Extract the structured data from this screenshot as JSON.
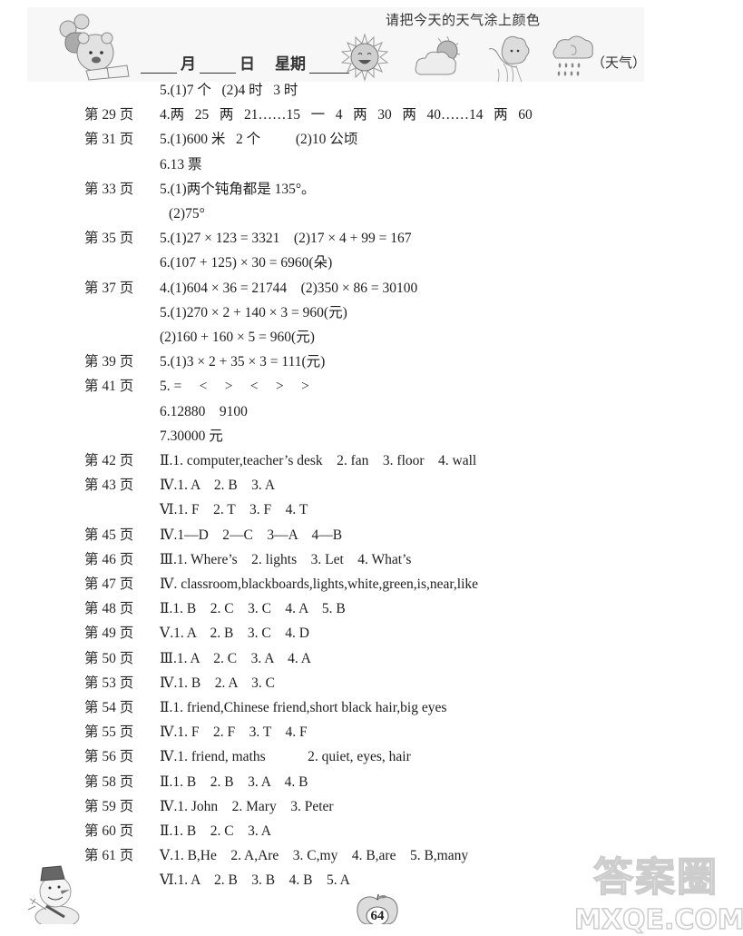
{
  "header": {
    "weather_prompt": "请把今天的天气涂上颜色",
    "month_label": "月",
    "day_label": "日",
    "weekday_label": "星期",
    "weather_label": "（天气）",
    "weather_icons": [
      "sunny-icon",
      "partly-cloudy-icon",
      "windy-icon",
      "rainy-icon"
    ]
  },
  "rows": [
    {
      "page": "",
      "answer": "5.(1)7 个   (2)4 时   3 时",
      "indent": false
    },
    {
      "page": "第 29 页",
      "answer": "4.两   25   两   21……15   一   4   两   30   两   40……14   两   60",
      "indent": false
    },
    {
      "page": "第 31 页",
      "answer": "5.(1)600 米   2 个          (2)10 公顷",
      "indent": false
    },
    {
      "page": "",
      "answer": "6.13 票",
      "indent": false
    },
    {
      "page": "第 33 页",
      "answer": "5.(1)两个钝角都是 135°。",
      "indent": false
    },
    {
      "page": "",
      "answer": "(2)75°",
      "indent": true
    },
    {
      "page": "第 35 页",
      "answer": "5.(1)27 × 123 = 3321    (2)17 × 4 + 99 = 167",
      "indent": false
    },
    {
      "page": "",
      "answer": "6.(107 + 125) × 30 = 6960(朵)",
      "indent": false
    },
    {
      "page": "第 37 页",
      "answer": "4.(1)604 × 36 = 21744    (2)350 × 86 = 30100",
      "indent": false
    },
    {
      "page": "",
      "answer": "5.(1)270 × 2 + 140 × 3 = 960(元)",
      "indent": false
    },
    {
      "page": "",
      "answer": "(2)160 + 160 × 5 = 960(元)",
      "indent": false
    },
    {
      "page": "第 39 页",
      "answer": "5.(1)3 × 2 + 35 × 3 = 111(元)",
      "indent": false
    },
    {
      "page": "第 41 页",
      "answer": "5. =     <     >     <     >     >",
      "indent": false
    },
    {
      "page": "",
      "answer": "6.12880    9100",
      "indent": false
    },
    {
      "page": "",
      "answer": "7.30000 元",
      "indent": false
    },
    {
      "page": "第 42 页",
      "answer": "Ⅱ.1. computer,teacher’s desk    2. fan    3. floor    4. wall",
      "indent": false
    },
    {
      "page": "第 43 页",
      "answer": "Ⅳ.1. A    2. B    3. A",
      "indent": false
    },
    {
      "page": "",
      "answer": "Ⅵ.1. F    2. T    3. F    4. T",
      "indent": false
    },
    {
      "page": "第 45 页",
      "answer": "Ⅳ.1—D    2—C    3—A    4—B",
      "indent": false
    },
    {
      "page": "第 46 页",
      "answer": "Ⅲ.1. Where’s    2. lights    3. Let    4. What’s",
      "indent": false
    },
    {
      "page": "第 47 页",
      "answer": "Ⅳ. classroom,blackboards,lights,white,green,is,near,like",
      "indent": false
    },
    {
      "page": "第 48 页",
      "answer": "Ⅱ.1. B    2. C    3. C    4. A    5. B",
      "indent": false
    },
    {
      "page": "第 49 页",
      "answer": "Ⅴ.1. A    2. B    3. C    4. D",
      "indent": false
    },
    {
      "page": "第 50 页",
      "answer": "Ⅲ.1. A    2. C    3. A    4. A",
      "indent": false
    },
    {
      "page": "第 53 页",
      "answer": "Ⅳ.1. B    2. A    3. C",
      "indent": false
    },
    {
      "page": "第 54 页",
      "answer": "Ⅱ.1. friend,Chinese friend,short black hair,big eyes",
      "indent": false
    },
    {
      "page": "第 55 页",
      "answer": "Ⅳ.1. F    2. F    3. T    4. F",
      "indent": false
    },
    {
      "page": "第 56 页",
      "answer": "Ⅳ.1. friend, maths            2. quiet, eyes, hair",
      "indent": false
    },
    {
      "page": "第 58 页",
      "answer": "Ⅱ.1. B    2. B    3. A    4. B",
      "indent": false
    },
    {
      "page": "第 59 页",
      "answer": "Ⅳ.1. John    2. Mary    3. Peter",
      "indent": false
    },
    {
      "page": "第 60 页",
      "answer": "Ⅱ.1. B    2. C    3. A",
      "indent": false
    },
    {
      "page": "第 61 页",
      "answer": "Ⅴ.1. B,He    2. A,Are    3. C,my    4. B,are    5. B,many",
      "indent": false
    },
    {
      "page": "",
      "answer": "Ⅵ.1. A    2. B    3. B    4. B    5. A",
      "indent": false
    }
  ],
  "footer": {
    "page_number": "64",
    "watermark_cn": "答案圈",
    "watermark_en": "MXQE.COM"
  }
}
